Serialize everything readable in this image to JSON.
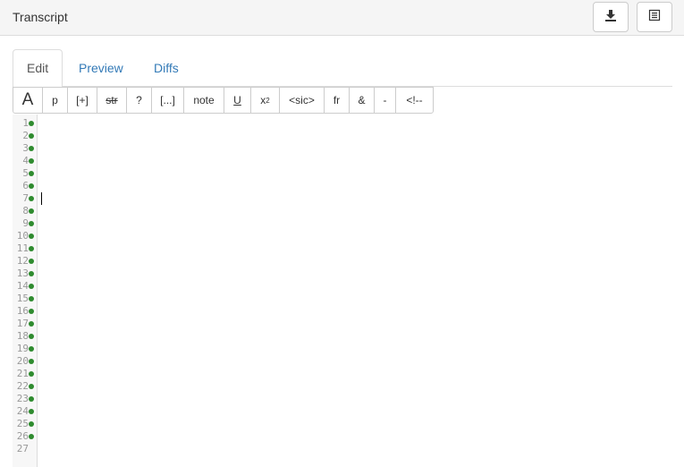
{
  "header": {
    "title": "Transcript",
    "download_icon": "download-icon",
    "list_icon": "list-view-icon"
  },
  "tabs": [
    {
      "label": "Edit",
      "active": true
    },
    {
      "label": "Preview",
      "active": false
    },
    {
      "label": "Diffs",
      "active": false
    }
  ],
  "toolbar": {
    "buttons": [
      {
        "label": "A",
        "name": "font-size-button"
      },
      {
        "label": "p",
        "name": "paragraph-button"
      },
      {
        "label": "[+]",
        "name": "insertion-button"
      },
      {
        "label": "str",
        "name": "strikethrough-button"
      },
      {
        "label": "?",
        "name": "unclear-button"
      },
      {
        "label": "[...]",
        "name": "gap-button"
      },
      {
        "label": "note",
        "name": "note-button"
      },
      {
        "label": "U",
        "name": "underline-button"
      },
      {
        "label": "x",
        "sup": "2",
        "name": "superscript-button"
      },
      {
        "label": "<sic>",
        "name": "sic-button"
      },
      {
        "label": "fr",
        "name": "fraction-button"
      },
      {
        "label": "&",
        "name": "ampersand-button"
      },
      {
        "label": "-",
        "name": "dash-button"
      },
      {
        "label": "<!--",
        "name": "comment-button"
      }
    ]
  },
  "editor": {
    "line_numbers": [
      "1",
      "2",
      "3",
      "4",
      "5",
      "6",
      "7",
      "8",
      "9",
      "10",
      "11",
      "12",
      "13",
      "14",
      "15",
      "16",
      "17",
      "18",
      "19",
      "20",
      "21",
      "22",
      "23",
      "24",
      "25",
      "26",
      "27"
    ],
    "marker_color": "#2e8b2e",
    "marked_lines": 26
  }
}
